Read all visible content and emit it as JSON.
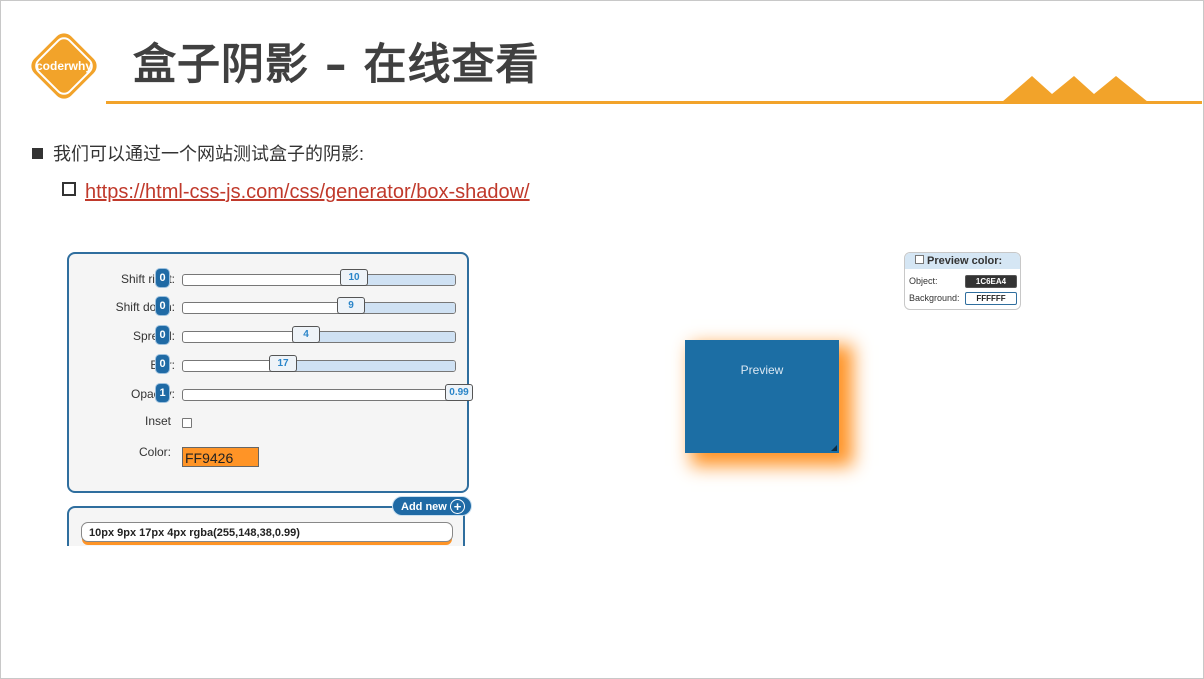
{
  "header": {
    "logo_text": "coderwhy",
    "title": "盒子阴影 – 在线查看"
  },
  "bullets": {
    "intro": "我们可以通过一个网站测试盒子的阴影:",
    "link": "https://html-css-js.com/css/generator/box-shadow/"
  },
  "controls": {
    "rows": [
      {
        "label": "Shift right:",
        "counter": "0",
        "value": "10",
        "level": 0.61
      },
      {
        "label": "Shift down:",
        "counter": "0",
        "value": "9",
        "level": 0.6
      },
      {
        "label": "Spread:",
        "counter": "0",
        "value": "4",
        "level": 0.45
      },
      {
        "label": "Blur:",
        "counter": "0",
        "value": "17",
        "level": 0.37
      },
      {
        "label": "Opacity:",
        "counter": "1",
        "value": "0.99",
        "level": 0.99
      }
    ],
    "inset_label": "Inset",
    "inset_checked": false,
    "color_label": "Color:",
    "color_value": "FF9426",
    "color_hex": "#ff9426"
  },
  "output": {
    "add_new_label": "Add new",
    "css_value": "10px 9px 17px 4px rgba(255,148,38,0.99)"
  },
  "preview": {
    "label": "Preview",
    "object_color": "#1c6ea4"
  },
  "preview_color": {
    "title": "Preview color:",
    "object_label": "Object:",
    "object_value": "1C6EA4",
    "background_label": "Background:",
    "background_value": "FFFFFF"
  },
  "colors": {
    "accent": "#f2a32a",
    "panel_border": "#2f6e9e",
    "link": "#c0392b"
  }
}
